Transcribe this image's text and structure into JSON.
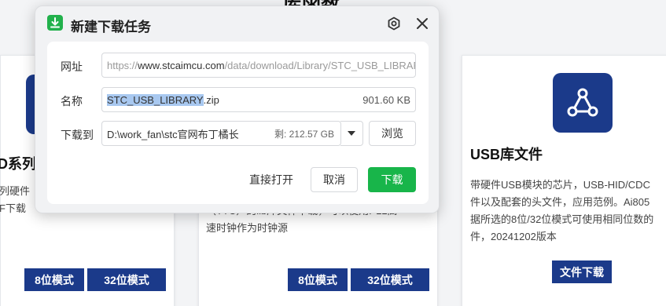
{
  "page": {
    "heading": "库函数"
  },
  "card_left": {
    "title": "D系列I",
    "desc_lines": [
      "列硬件",
      "F下载"
    ],
    "buttons": [
      "8位模式",
      "32位模式"
    ]
  },
  "card_mid": {
    "desc_lines": [
      "（TTC）的lib库文件下载，可以使用PLL高",
      "速时钟作为时钟源"
    ],
    "buttons": [
      "8位模式",
      "32位模式"
    ]
  },
  "card_right": {
    "title": "USB库文件",
    "desc_lines": [
      "带硬件USB模块的芯片，USB-HID/CDC",
      "件以及配套的头文件，应用范例。Ai805",
      "据所选的8位/32位模式可使用相同位数的",
      "件，20241202版本"
    ],
    "button": "文件下载"
  },
  "dialog": {
    "title": "新建下载任务",
    "url_label": "网址",
    "url_prefix": "https://",
    "url_host": "www.stcaimcu.com",
    "url_path": "/data/download/Library/STC_USB_LIBRAR",
    "name_label": "名称",
    "name_base": "STC_USB_LIBRARY",
    "name_ext": ".zip",
    "file_size": "901.60 KB",
    "save_label": "下载到",
    "save_path": "D:\\work_fan\\stc官网布丁橘长",
    "free_space": "剩: 212.57 GB",
    "browse_label": "浏览",
    "open_label": "直接打开",
    "cancel_label": "取消",
    "download_label": "下载"
  },
  "colors": {
    "brand_blue": "#1b3a8a",
    "download_green": "#18b54a",
    "selection": "#a8c8f0"
  }
}
